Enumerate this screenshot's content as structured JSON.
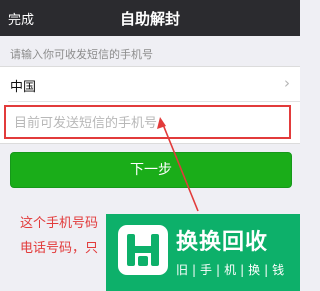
{
  "navbar": {
    "left_label": "完成",
    "title": "自助解封"
  },
  "hint": "请输入你可收发短信的手机号",
  "country": {
    "label": "中国",
    "chevron": "›"
  },
  "phone_input": {
    "placeholder": "目前可发送短信的手机号",
    "value": ""
  },
  "next_button": {
    "label": "下一步"
  },
  "annotation": {
    "line1": "这个手机号码",
    "line2": "电话号码，只"
  },
  "overlay_badge": {
    "title": "换换回收",
    "subtitle": "旧|手|机|换|钱"
  },
  "colors": {
    "navbar": "#2b2b2f",
    "primary": "#1aad19",
    "highlight": "#e23b3b",
    "badge": "#0db06a"
  }
}
